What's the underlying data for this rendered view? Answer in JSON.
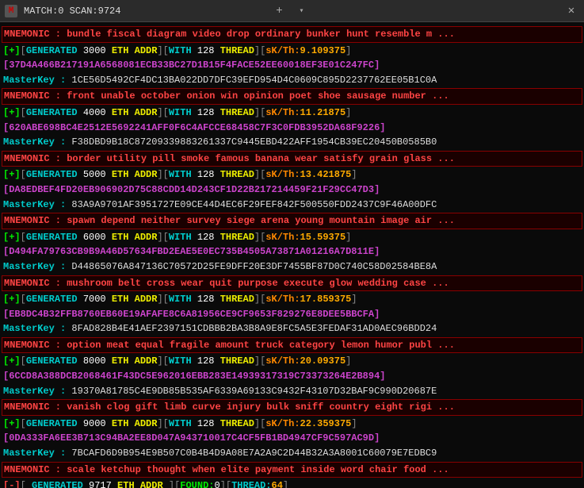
{
  "titleBar": {
    "icon": "M",
    "text": "MATCH:0 SCAN:9724",
    "closeLabel": "✕",
    "plusLabel": "+",
    "chevronLabel": "▾"
  },
  "lines": [
    {
      "type": "mnemonic",
      "text": "MNEMONIC : bundle fiscal diagram video drop ordinary bunker hunt resemble m ..."
    },
    {
      "type": "generated",
      "prefix": "[+][GENERATED",
      "amount": "3000",
      "unit": "ETH ADDR",
      "with": "WITH",
      "threads": "128",
      "threadLabel": "THREAD",
      "skth": "sK/Th:",
      "skval": "9.109375",
      "suffix": "]"
    },
    {
      "type": "hash",
      "text": "[37D4A466B217191A6568081ECB33BC27D1B15F4FACE52EE60018EF3E01C247FC]"
    },
    {
      "type": "masterkey",
      "label": "MasterKey :",
      "value": "1CE56D5492CF4DC13BA022DD7DFC39EFD954D4C0609C895D2237762EE05B1C0A"
    },
    {
      "type": "mnemonic",
      "text": "MNEMONIC : front unable october onion win opinion poet shoe sausage number ..."
    },
    {
      "type": "generated",
      "prefix": "[+][GENERATED",
      "amount": "4000",
      "unit": "ETH ADDR",
      "with": "WITH",
      "threads": "128",
      "threadLabel": "THREAD",
      "skth": "sK/Th:",
      "skval": "11.21875",
      "suffix": "]"
    },
    {
      "type": "hash",
      "text": "[620ABE698BC4E2512E5692241AFF0F6C4AFCCE68458C7F3C0FDB3952DA68F9226]"
    },
    {
      "type": "masterkey",
      "label": "MasterKey :",
      "value": "F38DBD9B18C87209339883261337C9445EBD422AFF1954CB39EC20450B0585B0"
    },
    {
      "type": "mnemonic",
      "text": "MNEMONIC : border utility pill smoke famous banana wear satisfy grain glass ..."
    },
    {
      "type": "generated",
      "prefix": "[+][GENERATED",
      "amount": "5000",
      "unit": "ETH ADDR",
      "with": "WITH",
      "threads": "128",
      "threadLabel": "THREAD",
      "skth": "sK/Th:",
      "skval": "13.421875",
      "suffix": "]"
    },
    {
      "type": "hash",
      "text": "[DA8EDBEF4FD20EB906902D75C88CDD14D243CF1D22B217214459F21F29CC47D3]"
    },
    {
      "type": "masterkey",
      "label": "MasterKey :",
      "value": "83A9A9701AF3951727E09CE44D4EC6F29FEF842F500550FDD2437C9F46A00DFC"
    },
    {
      "type": "mnemonic",
      "text": "MNEMONIC : spawn depend neither survey siege arena young mountain image air ..."
    },
    {
      "type": "generated",
      "prefix": "[+][GENERATED",
      "amount": "6000",
      "unit": "ETH ADDR",
      "with": "WITH",
      "threads": "128",
      "threadLabel": "THREAD",
      "skth": "sK/Th:",
      "skval": "15.59375",
      "suffix": "]"
    },
    {
      "type": "hash",
      "text": "[D494FA79763CB9B9A46D57634FBD2EAE5E0EC735B4505A73871A01216A7D811E]"
    },
    {
      "type": "masterkey",
      "label": "MasterKey :",
      "value": "D44865076A847136C70572D25FE9DFF20E3DF7455BF87D0C740C58D02584BE8A"
    },
    {
      "type": "mnemonic",
      "text": "MNEMONIC : mushroom belt cross wear quit purpose execute glow wedding case ..."
    },
    {
      "type": "generated",
      "prefix": "[+][GENERATED",
      "amount": "7000",
      "unit": "ETH ADDR",
      "with": "WITH",
      "threads": "128",
      "threadLabel": "THREAD",
      "skth": "sK/Th:",
      "skval": "17.859375",
      "suffix": "]"
    },
    {
      "type": "hash",
      "text": "[EB8DC4B32FFB8760EB60E19AFAFE8C6A81956CE9CF9653F829276E8DEE5BBCFA]"
    },
    {
      "type": "masterkey",
      "label": "MasterKey :",
      "value": "8FAD828B4E41AEF2397151CDBBB2BA3B8A9E8FC5A5E3FEDAF31AD0AEC96BDD24"
    },
    {
      "type": "mnemonic",
      "text": "MNEMONIC : option meat equal fragile amount truck category lemon humor publ ..."
    },
    {
      "type": "generated",
      "prefix": "[+][GENERATED",
      "amount": "8000",
      "unit": "ETH ADDR",
      "with": "WITH",
      "threads": "128",
      "threadLabel": "THREAD",
      "skth": "sK/Th:",
      "skval": "20.09375",
      "suffix": "]"
    },
    {
      "type": "hash",
      "text": "[6CCD8A388DCB2068461F43DC5E962016EBB283E14939317319C73373264E2B894]"
    },
    {
      "type": "masterkey",
      "label": "MasterKey :",
      "value": "19370A81785C4E9DB85B535AF6339A69133C9432F43107D32BAF9C990D20687E"
    },
    {
      "type": "mnemonic",
      "text": "MNEMONIC : vanish clog gift limb curve injury bulk sniff country eight rigi ..."
    },
    {
      "type": "generated",
      "prefix": "[+][GENERATED",
      "amount": "9000",
      "unit": "ETH ADDR",
      "with": "WITH",
      "threads": "128",
      "threadLabel": "THREAD",
      "skth": "sK/Th:",
      "skval": "22.359375",
      "suffix": "]"
    },
    {
      "type": "hash",
      "text": "[0DA333FA6EE3B713C94BA2EE8D047A943710017C4CF5FB1BD4947CF9C597AC9D]"
    },
    {
      "type": "masterkey",
      "label": "MasterKey :",
      "value": "7BCAFD6D9B954E9B507C0B4B4D9A08E7A2A9C2D44B32A3A8001C60079E7EDBC9"
    },
    {
      "type": "mnemonic",
      "text": "MNEMONIC : scale ketchup thought when elite payment inside word chair food ..."
    },
    {
      "type": "bottom",
      "text": "[-][ GENERATED  9717  ETH ADDR  ][FOUND:0][THREAD:64]"
    }
  ]
}
